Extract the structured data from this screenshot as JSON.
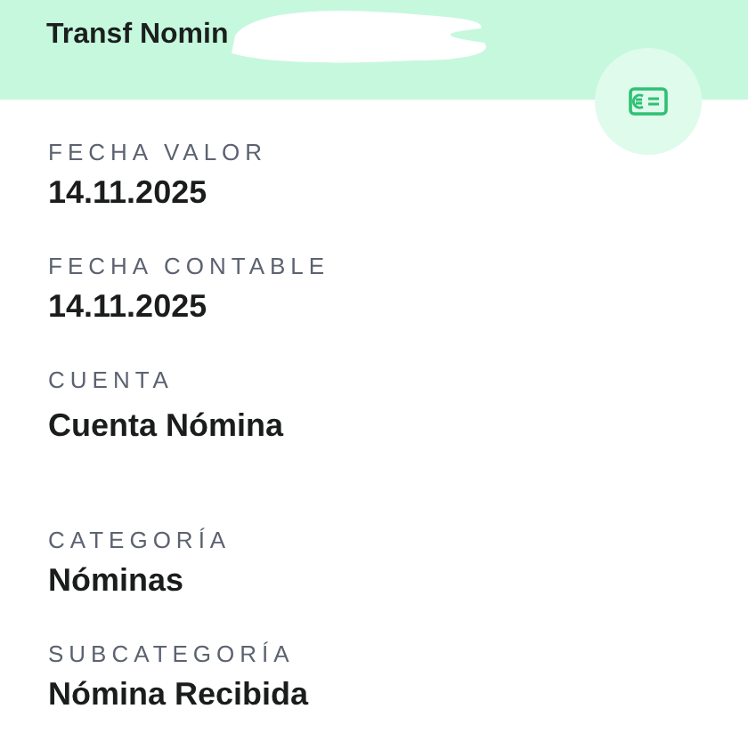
{
  "header": {
    "title": "Transf Nomin"
  },
  "fields": [
    {
      "label": "FECHA VALOR",
      "value": "14.11.2025"
    },
    {
      "label": "FECHA CONTABLE",
      "value": "14.11.2025"
    },
    {
      "label": "CUENTA",
      "value": "Cuenta Nómina"
    },
    {
      "label": "CATEGORÍA",
      "value": "Nóminas"
    },
    {
      "label": "SUBCATEGORÍA",
      "value": "Nómina Recibida"
    }
  ]
}
